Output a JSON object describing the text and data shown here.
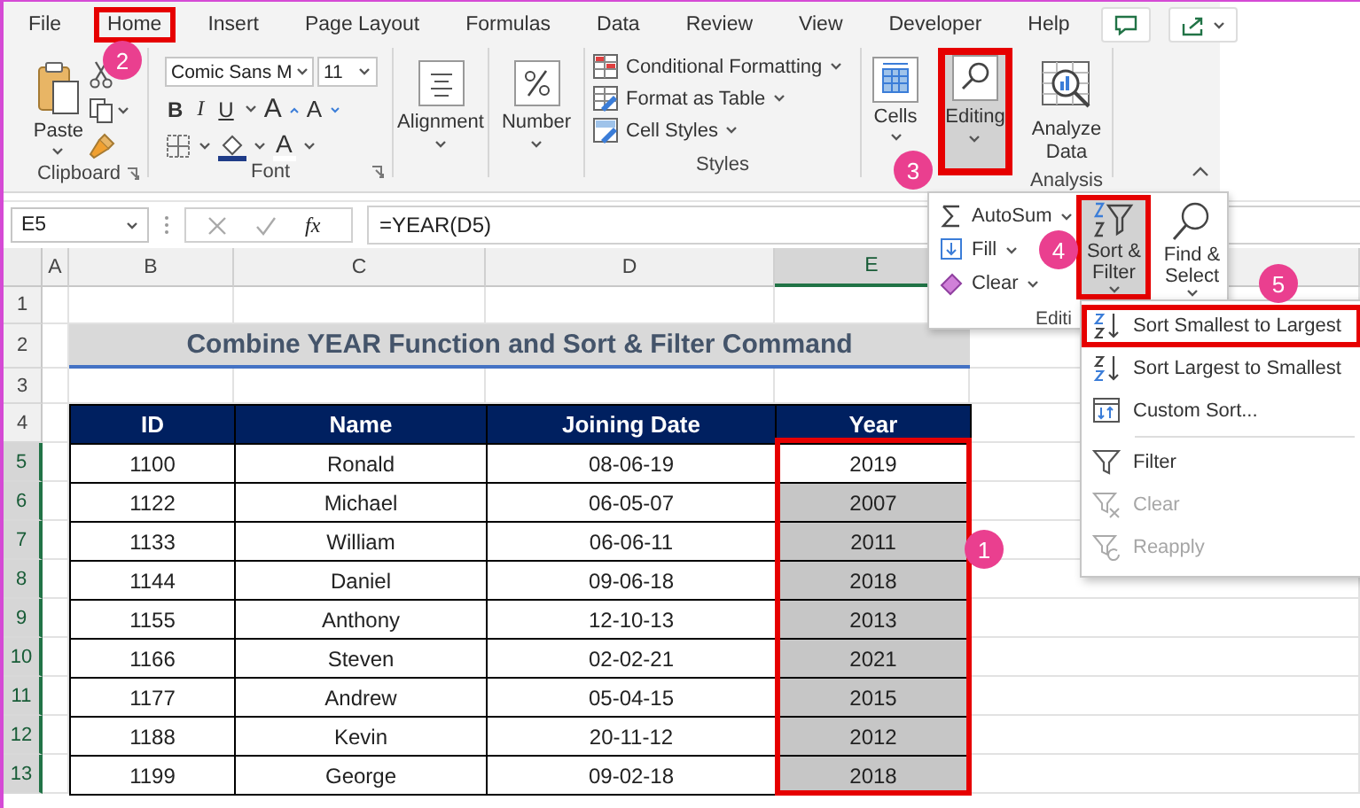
{
  "tabs": [
    {
      "label": "File",
      "outlined": false
    },
    {
      "label": "Home",
      "outlined": true,
      "callout": "2"
    },
    {
      "label": "Insert",
      "outlined": false
    },
    {
      "label": "Page Layout",
      "outlined": false
    },
    {
      "label": "Formulas",
      "outlined": false
    },
    {
      "label": "Data",
      "outlined": false
    },
    {
      "label": "Review",
      "outlined": false
    },
    {
      "label": "View",
      "outlined": false
    },
    {
      "label": "Developer",
      "outlined": false
    },
    {
      "label": "Help",
      "outlined": false
    }
  ],
  "ribbon": {
    "clipboard": {
      "paste": "Paste",
      "label": "Clipboard"
    },
    "font": {
      "name": "Comic Sans M",
      "size": "11",
      "bold": "B",
      "italic": "I",
      "underline": "U",
      "grow": "A",
      "shrink": "A",
      "font_color_button": "A",
      "label": "Font"
    },
    "alignment": "Alignment",
    "number": "Number",
    "styles": {
      "items": [
        "Conditional Formatting",
        "Format as Table",
        "Cell Styles"
      ],
      "label": "Styles"
    },
    "cells": "Cells",
    "editing": {
      "label": "Editing",
      "open": true,
      "outlined": true,
      "callout": "3"
    },
    "analysis": {
      "button": "Analyze Data",
      "label": "Analysis"
    }
  },
  "editing_panel": {
    "items": [
      "AutoSum",
      "Fill",
      "Clear"
    ],
    "label": "Editi",
    "sort_filter": {
      "label": "Sort & Filter",
      "open": true,
      "outlined": true,
      "callout": "4"
    },
    "find_select": "Find & Select"
  },
  "sort_menu": [
    {
      "label": "Sort Smallest to Largest",
      "disabled": false,
      "outlined": true,
      "separator_before": false,
      "callout": "5"
    },
    {
      "label": "Sort Largest to Smallest",
      "disabled": false,
      "outlined": false,
      "separator_before": false
    },
    {
      "label": "Custom Sort...",
      "disabled": false,
      "outlined": false,
      "separator_before": false
    },
    {
      "label": "Filter",
      "disabled": false,
      "outlined": false,
      "separator_before": true
    },
    {
      "label": "Clear",
      "disabled": true,
      "outlined": false,
      "separator_before": false
    },
    {
      "label": "Reapply",
      "disabled": true,
      "outlined": false,
      "separator_before": false
    }
  ],
  "formula_bar": {
    "name_box": "E5",
    "fx": "fx",
    "formula": "=YEAR(D5)"
  },
  "sheet": {
    "columns": [
      {
        "label": "A",
        "selected": false
      },
      {
        "label": "B",
        "selected": false
      },
      {
        "label": "C",
        "selected": false
      },
      {
        "label": "D",
        "selected": false
      },
      {
        "label": "E",
        "selected": true
      }
    ],
    "rows": [
      {
        "label": "1",
        "selected": false
      },
      {
        "label": "2",
        "selected": false
      },
      {
        "label": "3",
        "selected": false
      },
      {
        "label": "4",
        "selected": false
      },
      {
        "label": "5",
        "selected": true
      },
      {
        "label": "6",
        "selected": true
      },
      {
        "label": "7",
        "selected": true
      },
      {
        "label": "8",
        "selected": true
      },
      {
        "label": "9",
        "selected": true
      },
      {
        "label": "10",
        "selected": true
      },
      {
        "label": "11",
        "selected": true
      },
      {
        "label": "12",
        "selected": true
      },
      {
        "label": "13",
        "selected": true
      }
    ],
    "title": "Combine YEAR Function and Sort & Filter Command",
    "table": {
      "columns": [
        "ID",
        "Name",
        "Joining Date",
        "Year"
      ],
      "rows": [
        {
          "cells": [
            "1100",
            "Ronald",
            "08-06-19",
            "2019"
          ],
          "selected": false
        },
        {
          "cells": [
            "1122",
            "Michael",
            "06-05-07",
            "2007"
          ],
          "selected": true
        },
        {
          "cells": [
            "1133",
            "William",
            "06-06-11",
            "2011"
          ],
          "selected": true
        },
        {
          "cells": [
            "1144",
            "Daniel",
            "09-06-18",
            "2018"
          ],
          "selected": true
        },
        {
          "cells": [
            "1155",
            "Anthony",
            "12-10-13",
            "2013"
          ],
          "selected": true
        },
        {
          "cells": [
            "1166",
            "Steven",
            "02-02-21",
            "2021"
          ],
          "selected": true
        },
        {
          "cells": [
            "1177",
            "Andrew",
            "05-04-15",
            "2015"
          ],
          "selected": true
        },
        {
          "cells": [
            "1188",
            "Kevin",
            "20-11-12",
            "2012"
          ],
          "selected": true
        },
        {
          "cells": [
            "1199",
            "George",
            "09-02-18",
            "2018"
          ],
          "selected": true
        }
      ],
      "year_outline": {
        "outlined": true,
        "callout": "1"
      }
    }
  }
}
